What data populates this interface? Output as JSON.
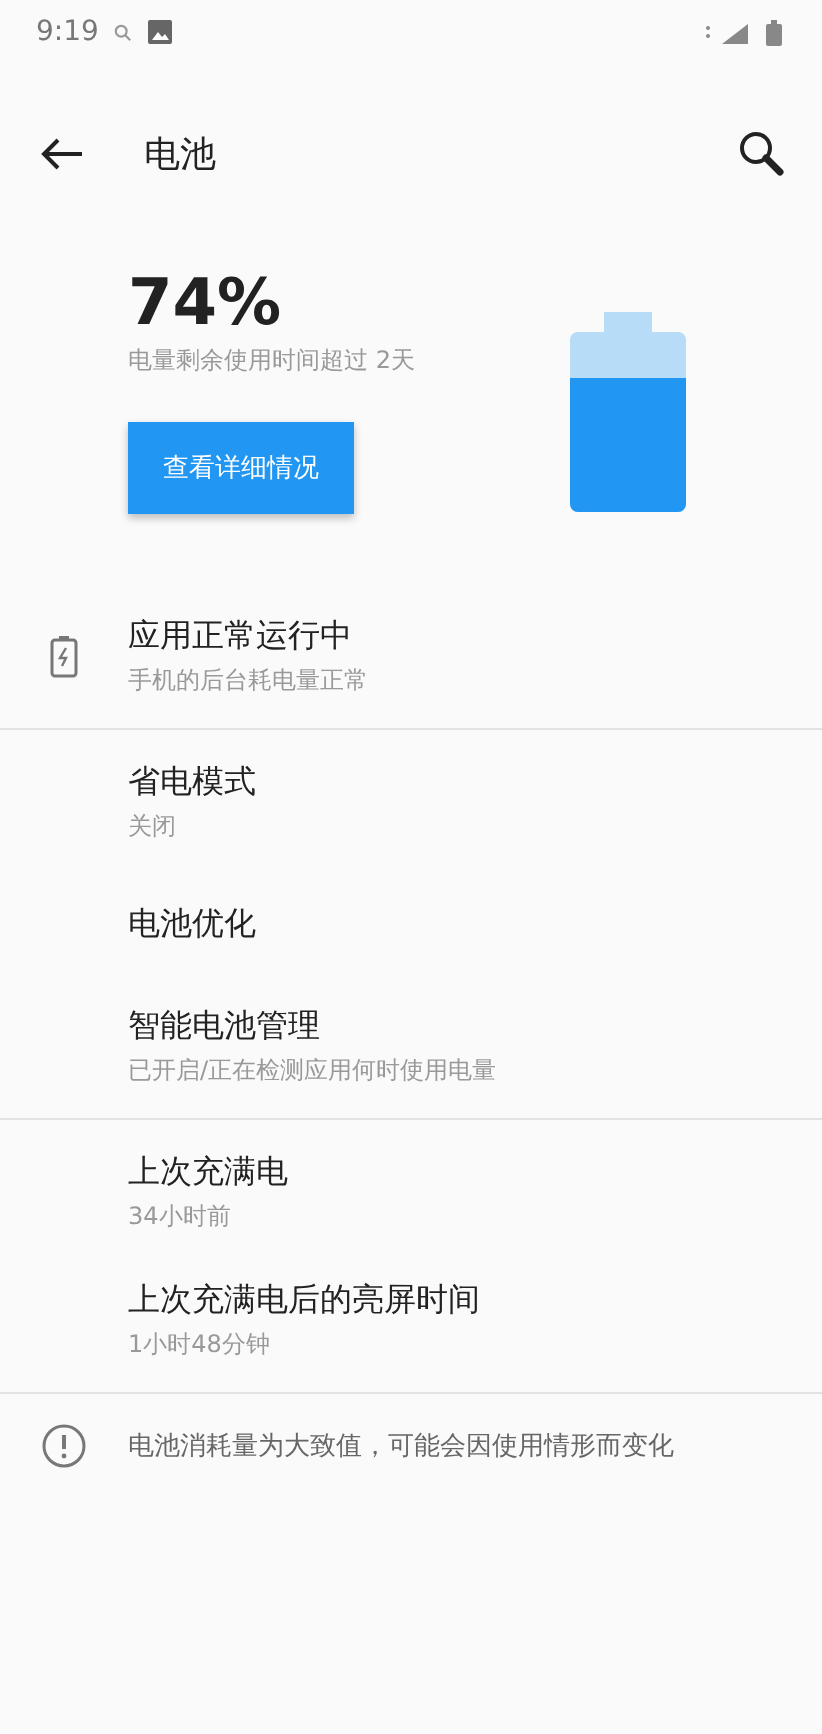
{
  "status_bar": {
    "time": "9:19"
  },
  "toolbar": {
    "title": "电池"
  },
  "summary": {
    "percent": "74%",
    "remaining": "电量剩余使用时间超过 2天",
    "button": "查看详细情况"
  },
  "groups": [
    {
      "items": [
        {
          "title": "应用正常运行中",
          "subtitle": "手机的后台耗电量正常",
          "icon": true
        }
      ]
    },
    {
      "items": [
        {
          "title": "省电模式",
          "subtitle": "关闭"
        },
        {
          "title": "电池优化"
        },
        {
          "title": "智能电池管理",
          "subtitle": "已开启/正在检测应用何时使用电量"
        }
      ]
    },
    {
      "items": [
        {
          "title": "上次充满电",
          "subtitle": "34小时前"
        },
        {
          "title": "上次充满电后的亮屏时间",
          "subtitle": "1小时48分钟"
        }
      ]
    }
  ],
  "footer": "电池消耗量为大致值，可能会因使用情形而变化"
}
